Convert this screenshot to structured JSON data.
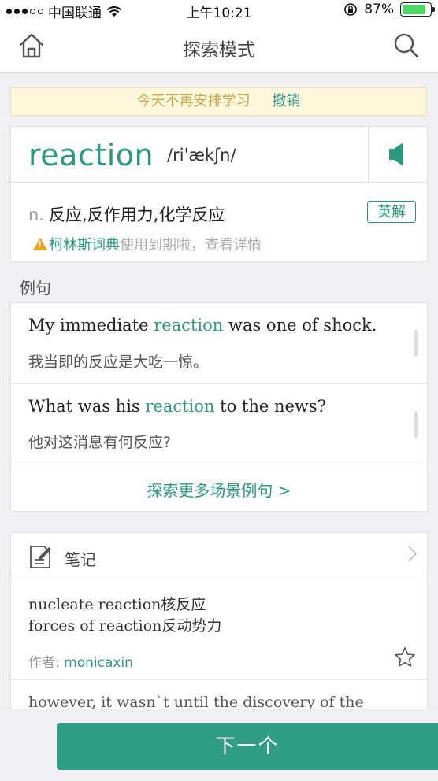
{
  "status_bar": {
    "carrier": "中国联通",
    "time": "上午10:21",
    "battery_percent": "87%",
    "battery_level": 0.87,
    "battery_color": "#4cd964"
  },
  "nav": {
    "title": "探索模式",
    "home_icon": "home-icon",
    "search_icon": "search-icon"
  },
  "banner": {
    "message": "今天不再安排学习",
    "undo_label": "撤销"
  },
  "word": {
    "text": "reaction",
    "phonetic": "/riˈækʃn/",
    "pos": "n.",
    "definition": "反应,反作用力,化学反应",
    "english_button": "英解",
    "collins_dict": "柯林斯词典",
    "collins_note": "使用到期啦，查看详情"
  },
  "examples": {
    "section_label": "例句",
    "items": [
      {
        "en_before": "My immediate ",
        "en_highlight": "reaction",
        "en_after": " was one of shock.",
        "zh": "我当即的反应是大吃一惊。"
      },
      {
        "en_before": "What was his ",
        "en_highlight": "reaction",
        "en_after": " to the news?",
        "zh": "他对这消息有何反应?"
      }
    ],
    "more_label": "探索更多场景例句 >"
  },
  "notes": {
    "title": "笔记",
    "lines": [
      "nucleate reaction核反应",
      "forces of reaction反动势力"
    ],
    "author_label": "作者:",
    "author_name": "monicaxin",
    "next_preview": "however, it wasn`t until the discovery of the"
  },
  "bottom": {
    "next_label": "下一个"
  },
  "colors": {
    "accent": "#2a9a7f",
    "banner_bg": "#fdf8db",
    "banner_text": "#c9a74f"
  }
}
